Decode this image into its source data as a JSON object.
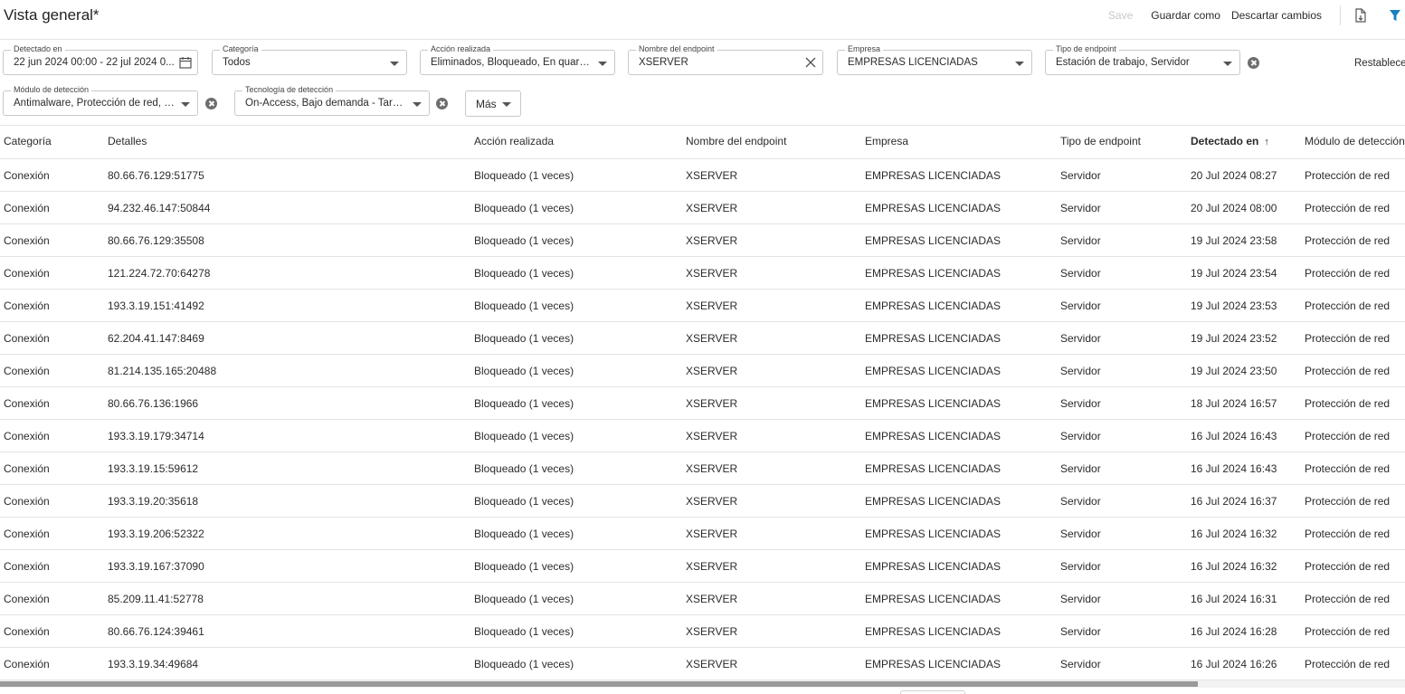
{
  "header": {
    "title": "Vista general*",
    "save_label": "Save",
    "save_as_label": "Guardar como",
    "discard_label": "Descartar cambios"
  },
  "filters": {
    "detected": {
      "label": "Detectado en",
      "value": "22 jun 2024 00:00 - 22 jul 2024 0..."
    },
    "category": {
      "label": "Categoría",
      "value": "Todos"
    },
    "action": {
      "label": "Acción realizada",
      "value": "Eliminados, Bloqueado, En quaren..."
    },
    "endpoint_name": {
      "label": "Nombre del endpoint",
      "value": "XSERVER"
    },
    "company": {
      "label": "Empresa",
      "value": "EMPRESAS LICENCIADAS"
    },
    "endpoint_type": {
      "label": "Tipo de endpoint",
      "value": "Estación de trabajo, Servidor"
    },
    "module": {
      "label": "Módulo de detección",
      "value": "Antimalware, Protección de red, P..."
    },
    "technology": {
      "label": "Tecnología de detección",
      "value": "On-Access, Bajo demanda - Tarea..."
    },
    "more_label": "Más",
    "reset_label": "Restablecer"
  },
  "table": {
    "columns": [
      "Categoría",
      "Detalles",
      "Acción realizada",
      "Nombre del endpoint",
      "Empresa",
      "Tipo de endpoint",
      "Detectado en",
      "Módulo de detección"
    ],
    "sort_arrow": "↑",
    "rows": [
      [
        "Conexión",
        "80.66.76.129:51775",
        "Bloqueado (1 veces)",
        "XSERVER",
        "EMPRESAS LICENCIADAS",
        "Servidor",
        "20 Jul 2024 08:27",
        "Protección de red"
      ],
      [
        "Conexión",
        "94.232.46.147:50844",
        "Bloqueado (1 veces)",
        "XSERVER",
        "EMPRESAS LICENCIADAS",
        "Servidor",
        "20 Jul 2024 08:00",
        "Protección de red"
      ],
      [
        "Conexión",
        "80.66.76.129:35508",
        "Bloqueado (1 veces)",
        "XSERVER",
        "EMPRESAS LICENCIADAS",
        "Servidor",
        "19 Jul 2024 23:58",
        "Protección de red"
      ],
      [
        "Conexión",
        "121.224.72.70:64278",
        "Bloqueado (1 veces)",
        "XSERVER",
        "EMPRESAS LICENCIADAS",
        "Servidor",
        "19 Jul 2024 23:54",
        "Protección de red"
      ],
      [
        "Conexión",
        "193.3.19.151:41492",
        "Bloqueado (1 veces)",
        "XSERVER",
        "EMPRESAS LICENCIADAS",
        "Servidor",
        "19 Jul 2024 23:53",
        "Protección de red"
      ],
      [
        "Conexión",
        "62.204.41.147:8469",
        "Bloqueado (1 veces)",
        "XSERVER",
        "EMPRESAS LICENCIADAS",
        "Servidor",
        "19 Jul 2024 23:52",
        "Protección de red"
      ],
      [
        "Conexión",
        "81.214.135.165:20488",
        "Bloqueado (1 veces)",
        "XSERVER",
        "EMPRESAS LICENCIADAS",
        "Servidor",
        "19 Jul 2024 23:50",
        "Protección de red"
      ],
      [
        "Conexión",
        "80.66.76.136:1966",
        "Bloqueado (1 veces)",
        "XSERVER",
        "EMPRESAS LICENCIADAS",
        "Servidor",
        "18 Jul 2024 16:57",
        "Protección de red"
      ],
      [
        "Conexión",
        "193.3.19.179:34714",
        "Bloqueado (1 veces)",
        "XSERVER",
        "EMPRESAS LICENCIADAS",
        "Servidor",
        "16 Jul 2024 16:43",
        "Protección de red"
      ],
      [
        "Conexión",
        "193.3.19.15:59612",
        "Bloqueado (1 veces)",
        "XSERVER",
        "EMPRESAS LICENCIADAS",
        "Servidor",
        "16 Jul 2024 16:43",
        "Protección de red"
      ],
      [
        "Conexión",
        "193.3.19.20:35618",
        "Bloqueado (1 veces)",
        "XSERVER",
        "EMPRESAS LICENCIADAS",
        "Servidor",
        "16 Jul 2024 16:37",
        "Protección de red"
      ],
      [
        "Conexión",
        "193.3.19.206:52322",
        "Bloqueado (1 veces)",
        "XSERVER",
        "EMPRESAS LICENCIADAS",
        "Servidor",
        "16 Jul 2024 16:32",
        "Protección de red"
      ],
      [
        "Conexión",
        "193.3.19.167:37090",
        "Bloqueado (1 veces)",
        "XSERVER",
        "EMPRESAS LICENCIADAS",
        "Servidor",
        "16 Jul 2024 16:32",
        "Protección de red"
      ],
      [
        "Conexión",
        "85.209.11.41:52778",
        "Bloqueado (1 veces)",
        "XSERVER",
        "EMPRESAS LICENCIADAS",
        "Servidor",
        "16 Jul 2024 16:31",
        "Protección de red"
      ],
      [
        "Conexión",
        "80.66.76.124:39461",
        "Bloqueado (1 veces)",
        "XSERVER",
        "EMPRESAS LICENCIADAS",
        "Servidor",
        "16 Jul 2024 16:28",
        "Protección de red"
      ],
      [
        "Conexión",
        "193.3.19.34:49684",
        "Bloqueado (1 veces)",
        "XSERVER",
        "EMPRESAS LICENCIADAS",
        "Servidor",
        "16 Jul 2024 16:26",
        "Protección de red"
      ]
    ]
  },
  "icons": {
    "export": "file-export-icon",
    "filter": "filter-icon",
    "calendar": "calendar-icon",
    "clear": "close-icon"
  },
  "colors": {
    "accent": "#1a7fc1",
    "text": "#2b2b2b",
    "border": "#e3e3e3",
    "disabled": "#c8c8c8"
  }
}
